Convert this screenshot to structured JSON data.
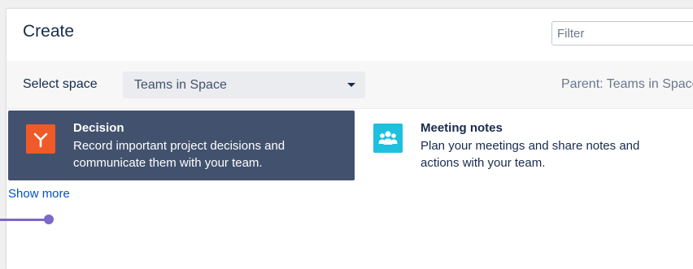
{
  "dialog": {
    "title": "Create",
    "filter": {
      "value": "",
      "placeholder": "Filter"
    }
  },
  "space": {
    "label": "Select space",
    "selected": "Teams in Space",
    "parent": "Parent: Teams in Space"
  },
  "templates": [
    {
      "name": "Decision",
      "description": "Record important project decisions and communicate them with your team.",
      "icon": "decision-icon",
      "selected": true,
      "icon_color": "#f05a28"
    },
    {
      "name": "Meeting notes",
      "description": "Plan your meetings and share notes and actions with your team.",
      "icon": "people-icon",
      "selected": false,
      "icon_color": "#1fbfde"
    }
  ],
  "show_more": "Show more",
  "colors": {
    "selected_card": "#42526e",
    "link": "#0052cc",
    "guide": "#7b68c9"
  }
}
